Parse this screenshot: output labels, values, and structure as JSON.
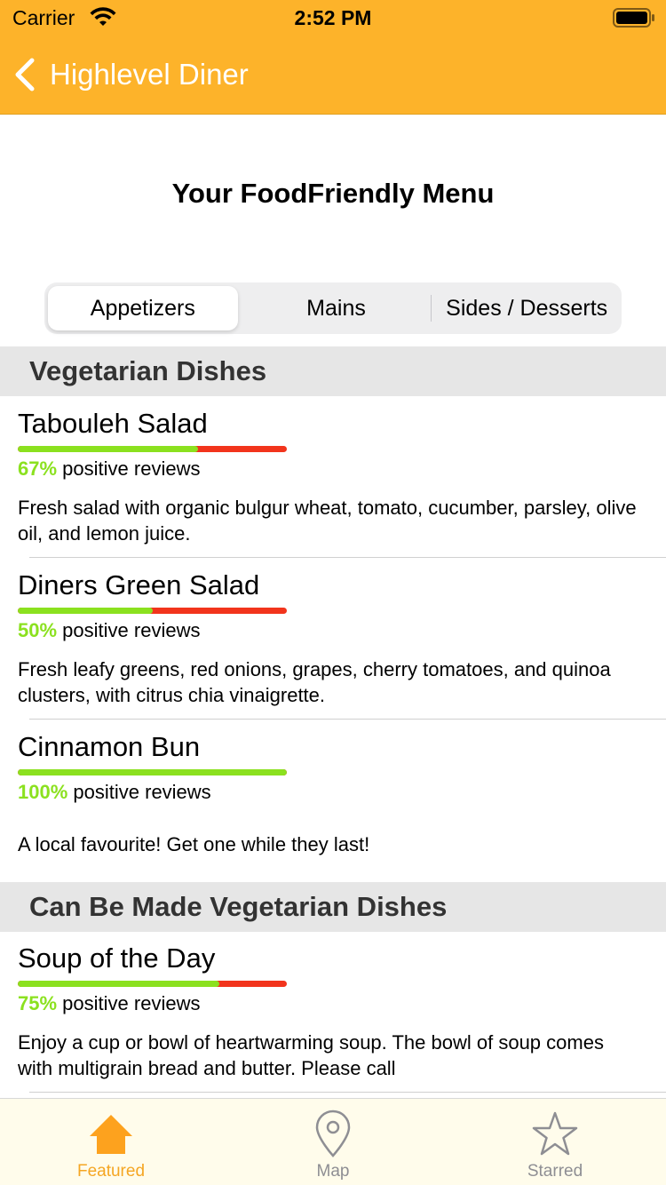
{
  "status_bar": {
    "carrier": "Carrier",
    "time": "2:52 PM"
  },
  "nav": {
    "back_label": "Highlevel Diner"
  },
  "page": {
    "title": "Your FoodFriendly Menu"
  },
  "segments": [
    "Appetizers",
    "Mains",
    "Sides / Desserts"
  ],
  "selected_segment": "Appetizers",
  "rating_suffix": "positive reviews",
  "sections": [
    {
      "header": "Vegetarian Dishes",
      "items": [
        {
          "title": "Tabouleh Salad",
          "rating_pct": "67%",
          "rating_fraction": 0.67,
          "description": "Fresh salad with organic bulgur wheat, tomato, cucumber, parsley, olive oil, and lemon juice."
        },
        {
          "title": "Diners Green Salad",
          "rating_pct": "50%",
          "rating_fraction": 0.5,
          "description": "Fresh leafy greens, red onions, grapes, cherry tomatoes, and quinoa clusters, with citrus chia vinaigrette."
        },
        {
          "title": "Cinnamon Bun",
          "rating_pct": "100%",
          "rating_fraction": 1.0,
          "description": "A local favourite! Get one while they last!"
        }
      ]
    },
    {
      "header": "Can Be Made Vegetarian Dishes",
      "items": [
        {
          "title": "Soup of the Day",
          "rating_pct": "75%",
          "rating_fraction": 0.75,
          "description": "Enjoy a cup or bowl of heartwarming soup. The bowl of soup comes with multigrain bread and butter. Please call"
        }
      ]
    }
  ],
  "tabs": [
    {
      "label": "Featured",
      "icon": "house-icon",
      "active": true
    },
    {
      "label": "Map",
      "icon": "map-pin-icon",
      "active": false
    },
    {
      "label": "Starred",
      "icon": "star-icon",
      "active": false
    }
  ],
  "colors": {
    "nav": "#FDB32A",
    "rating_positive": "#8BE11F",
    "rating_negative": "#F2341C",
    "tab_active": "#F5A623",
    "tab_inactive": "#8e8e93",
    "section_header_bg": "#e6e6e6"
  }
}
